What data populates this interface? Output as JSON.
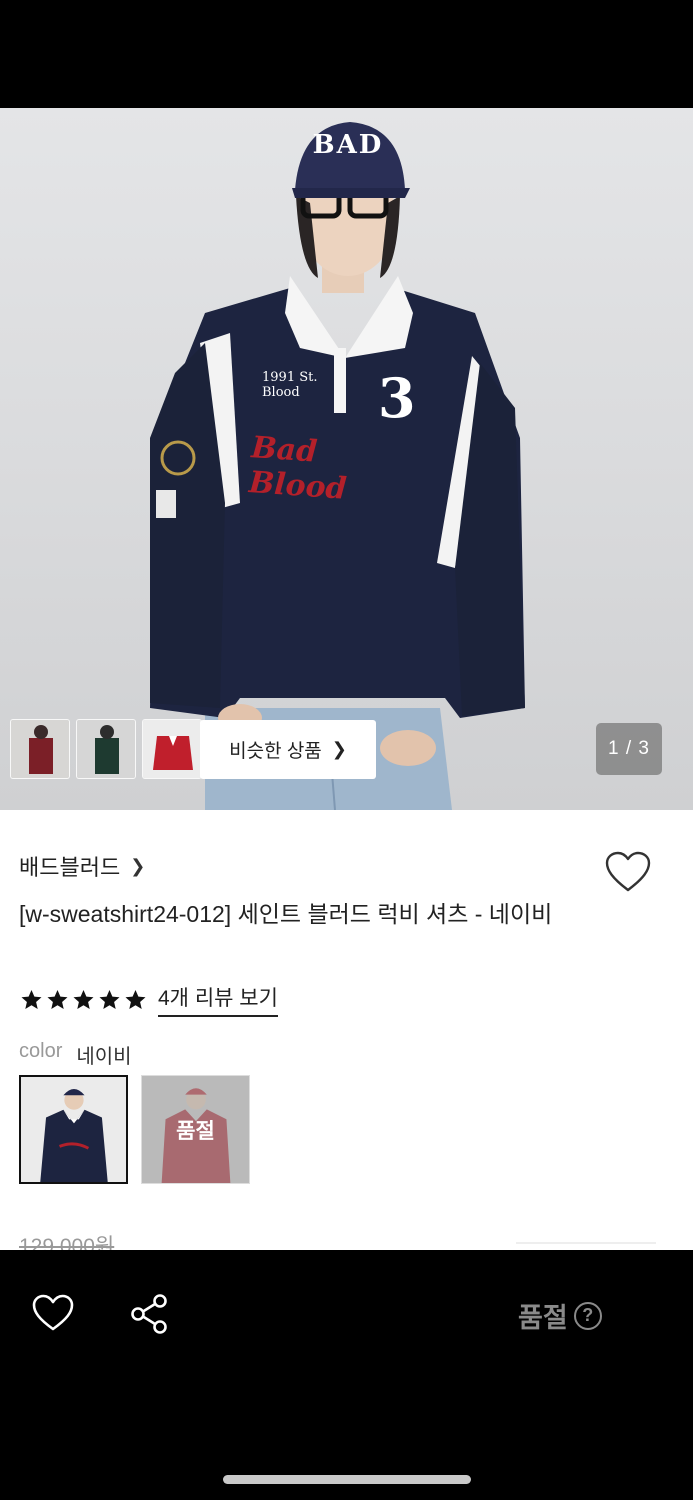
{
  "gallery": {
    "similar_label": "비슷한 상품",
    "page_counter": "1 / 3",
    "thumbnails": [
      "thumb-red-outfit",
      "thumb-green-outfit",
      "thumb-red-jacket"
    ],
    "hero_lettering": {
      "cap": "BAD",
      "chest_patch": "1991 St. Blood",
      "number": "3",
      "script": "Bad Blood"
    }
  },
  "product": {
    "brand": "배드블러드",
    "title": "[w-sweatshirt24-012] 세인트 블러드 럭비 셔츠 - 네이비",
    "rating_stars": 5,
    "review_link": "4개 리뷰 보기",
    "color_label": "color",
    "color_value": "네이비",
    "swatches": [
      {
        "name": "네이비",
        "selected": true,
        "soldout": false
      },
      {
        "name": "레드",
        "selected": false,
        "soldout": true,
        "soldout_label": "품절"
      }
    ],
    "original_price": "129,000원"
  },
  "bottom_bar": {
    "status_label": "품절",
    "help_glyph": "?"
  },
  "colors": {
    "navy": "#1d2440",
    "red": "#b3202a",
    "text": "#222222",
    "muted": "#999999"
  }
}
